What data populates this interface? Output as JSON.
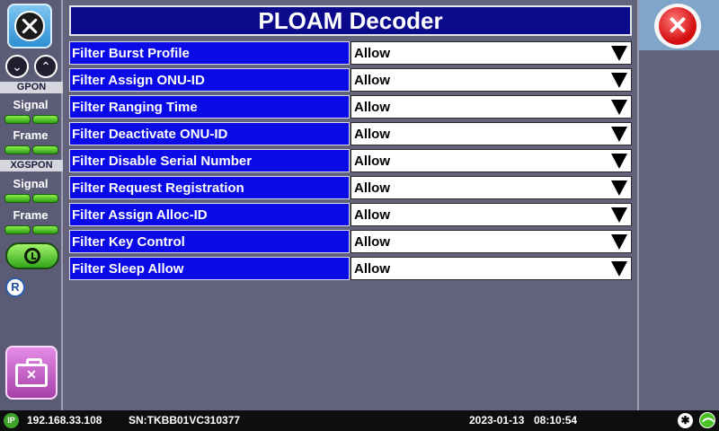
{
  "title": "PLOAM Decoder",
  "sidebar": {
    "section_gpon": "GPON",
    "section_xgspon": "XGSPON",
    "gpon_signal": "Signal",
    "gpon_frame": "Frame",
    "xgspon_signal": "Signal",
    "xgspon_frame": "Frame",
    "badge": "R"
  },
  "filters": [
    {
      "label": "Filter Burst Profile",
      "value": "Allow"
    },
    {
      "label": "Filter Assign ONU-ID",
      "value": "Allow"
    },
    {
      "label": "Filter Ranging Time",
      "value": "Allow"
    },
    {
      "label": "Filter Deactivate ONU-ID",
      "value": "Allow"
    },
    {
      "label": "Filter Disable Serial Number",
      "value": "Allow"
    },
    {
      "label": "Filter Request Registration",
      "value": "Allow"
    },
    {
      "label": "Filter Assign Alloc-ID",
      "value": "Allow"
    },
    {
      "label": "Filter Key Control",
      "value": "Allow"
    },
    {
      "label": "Filter Sleep Allow",
      "value": "Allow"
    }
  ],
  "statusbar": {
    "ip_label": "IP",
    "ip": "192.168.33.108",
    "serial": "SN:TKBB01VC310377",
    "date": "2023-01-13",
    "time": "08:10:54"
  },
  "colors": {
    "title_bg": "#0a0a8a",
    "label_bg": "#0a0ae6",
    "led_green": "#4ad12a",
    "close_red": "#d40d0d"
  }
}
